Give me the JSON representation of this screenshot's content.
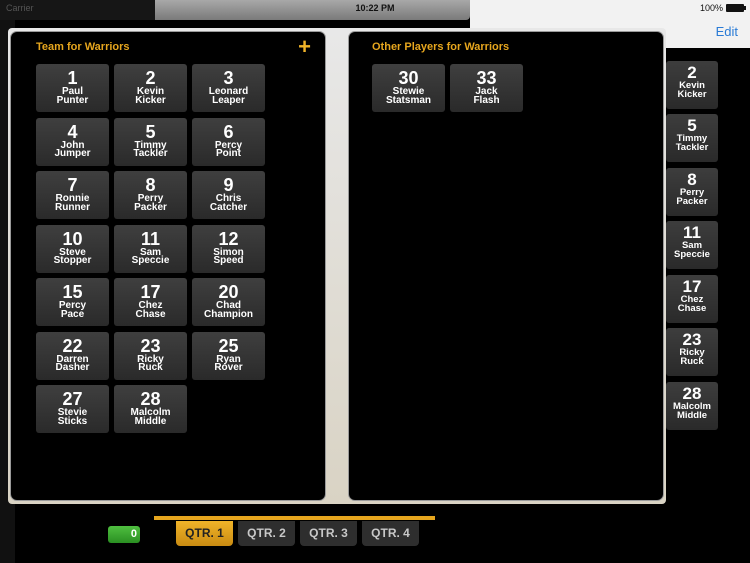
{
  "status_bar": {
    "carrier": "Carrier",
    "time": "10:22 PM",
    "battery": "100%"
  },
  "nav": {
    "edit_label": "Edit"
  },
  "team_panel": {
    "title": "Team for Warriors",
    "add_icon": "plus-icon",
    "players": [
      {
        "number": "1",
        "name": "Paul\nPunter"
      },
      {
        "number": "2",
        "name": "Kevin\nKicker"
      },
      {
        "number": "3",
        "name": "Leonard\nLeaper"
      },
      {
        "number": "4",
        "name": "John\nJumper"
      },
      {
        "number": "5",
        "name": "Timmy\nTackler"
      },
      {
        "number": "6",
        "name": "Percy\nPoint"
      },
      {
        "number": "7",
        "name": "Ronnie\nRunner"
      },
      {
        "number": "8",
        "name": "Perry\nPacker"
      },
      {
        "number": "9",
        "name": "Chris\nCatcher"
      },
      {
        "number": "10",
        "name": "Steve\nStopper"
      },
      {
        "number": "11",
        "name": "Sam\nSpeccie"
      },
      {
        "number": "12",
        "name": "Simon\nSpeed"
      },
      {
        "number": "15",
        "name": "Percy\nPace"
      },
      {
        "number": "17",
        "name": "Chez\nChase"
      },
      {
        "number": "20",
        "name": "Chad\nChampion"
      },
      {
        "number": "22",
        "name": "Darren\nDasher"
      },
      {
        "number": "23",
        "name": "Ricky\nRuck"
      },
      {
        "number": "25",
        "name": "Ryan\nRover"
      },
      {
        "number": "27",
        "name": "Stevie\nSticks"
      },
      {
        "number": "28",
        "name": "Malcolm\nMiddle"
      }
    ]
  },
  "other_panel": {
    "title": "Other Players for Warriors",
    "players": [
      {
        "number": "30",
        "name": "Stewie\nStatsman"
      },
      {
        "number": "33",
        "name": "Jack\nFlash"
      }
    ]
  },
  "side_list": {
    "players": [
      {
        "number": "2",
        "name": "Kevin\nKicker"
      },
      {
        "number": "5",
        "name": "Timmy\nTackler"
      },
      {
        "number": "8",
        "name": "Perry\nPacker"
      },
      {
        "number": "11",
        "name": "Sam\nSpeccie"
      },
      {
        "number": "17",
        "name": "Chez\nChase"
      },
      {
        "number": "23",
        "name": "Ricky\nRuck"
      },
      {
        "number": "28",
        "name": "Malcolm\nMiddle"
      }
    ]
  },
  "score": {
    "value": "0"
  },
  "quarters": {
    "tabs": [
      "QTR. 1",
      "QTR. 2",
      "QTR. 3",
      "QTR. 4"
    ],
    "active_index": 0
  },
  "colors": {
    "accent": "#e6a61e",
    "link": "#2a7bd6",
    "score_green": "#3aa830"
  }
}
